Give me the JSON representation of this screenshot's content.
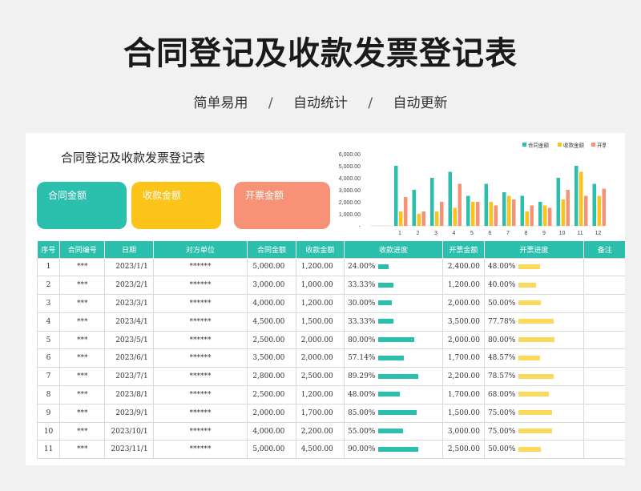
{
  "page": {
    "title": "合同登记及收款发票登记表",
    "features": [
      "简单易用",
      "自动统计",
      "自动更新"
    ],
    "separator": "/"
  },
  "sheet": {
    "title": "合同登记及收款发票登记表",
    "cards": [
      {
        "label": "合同金额",
        "color": "#2bbfae"
      },
      {
        "label": "收款金额",
        "color": "#fcc419"
      },
      {
        "label": "开票金额",
        "color": "#f79277"
      }
    ]
  },
  "table": {
    "headers": [
      "序号",
      "合同编号",
      "日期",
      "对方单位",
      "合同金额",
      "收款金额",
      "收款进度",
      "开票金额",
      "开票进度",
      "备注"
    ],
    "rows": [
      {
        "no": "1",
        "code": "***",
        "date": "2023/1/1",
        "party": "******",
        "contract": "5,000.00",
        "received": "1,200.00",
        "recv_pct": "24.00%",
        "recv_frac": 0.24,
        "invoiced": "2,400.00",
        "inv_pct": "48.00%",
        "inv_frac": 0.48,
        "note": ""
      },
      {
        "no": "2",
        "code": "***",
        "date": "2023/2/1",
        "party": "******",
        "contract": "3,000.00",
        "received": "1,000.00",
        "recv_pct": "33.33%",
        "recv_frac": 0.3333,
        "invoiced": "1,200.00",
        "inv_pct": "40.00%",
        "inv_frac": 0.4,
        "note": ""
      },
      {
        "no": "3",
        "code": "***",
        "date": "2023/3/1",
        "party": "******",
        "contract": "4,000.00",
        "received": "1,200.00",
        "recv_pct": "30.00%",
        "recv_frac": 0.3,
        "invoiced": "2,000.00",
        "inv_pct": "50.00%",
        "inv_frac": 0.5,
        "note": ""
      },
      {
        "no": "4",
        "code": "***",
        "date": "2023/4/1",
        "party": "******",
        "contract": "4,500.00",
        "received": "1,500.00",
        "recv_pct": "33.33%",
        "recv_frac": 0.3333,
        "invoiced": "3,500.00",
        "inv_pct": "77.78%",
        "inv_frac": 0.7778,
        "note": ""
      },
      {
        "no": "5",
        "code": "***",
        "date": "2023/5/1",
        "party": "******",
        "contract": "2,500.00",
        "received": "2,000.00",
        "recv_pct": "80.00%",
        "recv_frac": 0.8,
        "invoiced": "2,000.00",
        "inv_pct": "80.00%",
        "inv_frac": 0.8,
        "note": ""
      },
      {
        "no": "6",
        "code": "***",
        "date": "2023/6/1",
        "party": "******",
        "contract": "3,500.00",
        "received": "2,000.00",
        "recv_pct": "57.14%",
        "recv_frac": 0.5714,
        "invoiced": "1,700.00",
        "inv_pct": "48.57%",
        "inv_frac": 0.4857,
        "note": ""
      },
      {
        "no": "7",
        "code": "***",
        "date": "2023/7/1",
        "party": "******",
        "contract": "2,800.00",
        "received": "2,500.00",
        "recv_pct": "89.29%",
        "recv_frac": 0.8929,
        "invoiced": "2,200.00",
        "inv_pct": "78.57%",
        "inv_frac": 0.7857,
        "note": ""
      },
      {
        "no": "8",
        "code": "***",
        "date": "2023/8/1",
        "party": "******",
        "contract": "2,500.00",
        "received": "1,200.00",
        "recv_pct": "48.00%",
        "recv_frac": 0.48,
        "invoiced": "1,700.00",
        "inv_pct": "68.00%",
        "inv_frac": 0.68,
        "note": ""
      },
      {
        "no": "9",
        "code": "***",
        "date": "2023/9/1",
        "party": "******",
        "contract": "2,000.00",
        "received": "1,700.00",
        "recv_pct": "85.00%",
        "recv_frac": 0.85,
        "invoiced": "1,500.00",
        "inv_pct": "75.00%",
        "inv_frac": 0.75,
        "note": ""
      },
      {
        "no": "10",
        "code": "***",
        "date": "2023/10/1",
        "party": "******",
        "contract": "4,000.00",
        "received": "2,200.00",
        "recv_pct": "55.00%",
        "recv_frac": 0.55,
        "invoiced": "3,000.00",
        "inv_pct": "75.00%",
        "inv_frac": 0.75,
        "note": ""
      },
      {
        "no": "11",
        "code": "***",
        "date": "2023/11/1",
        "party": "******",
        "contract": "5,000.00",
        "received": "4,500.00",
        "recv_pct": "90.00%",
        "recv_frac": 0.9,
        "invoiced": "2,500.00",
        "inv_pct": "50.00%",
        "inv_frac": 0.5,
        "note": ""
      }
    ]
  },
  "chart_data": {
    "type": "bar",
    "categories": [
      "1",
      "2",
      "3",
      "4",
      "5",
      "6",
      "7",
      "8",
      "9",
      "10",
      "11",
      "12"
    ],
    "series": [
      {
        "name": "合同金额",
        "color": "#2bbfae",
        "values": [
          5000,
          3000,
          4000,
          4500,
          2500,
          3500,
          2800,
          2500,
          2000,
          4000,
          5000,
          3500
        ]
      },
      {
        "name": "收款金额",
        "color": "#fcc419",
        "values": [
          1200,
          1000,
          1200,
          1500,
          2000,
          2000,
          2500,
          1200,
          1700,
          2200,
          4500,
          2500
        ]
      },
      {
        "name": "开票金额",
        "color": "#f79277",
        "values": [
          2400,
          1200,
          2000,
          3500,
          2000,
          1700,
          2200,
          1700,
          1500,
          3000,
          2500,
          3100
        ]
      }
    ],
    "yticks": [
      "-",
      "1,000.00",
      "2,000.00",
      "3,000.00",
      "4,000.00",
      "5,000.00",
      "6,000.00"
    ],
    "ylim": [
      0,
      6000
    ],
    "legend_labels": [
      "合同金额",
      "收款金额",
      "开票金"
    ],
    "legend_position": "top-right",
    "grid": false
  }
}
